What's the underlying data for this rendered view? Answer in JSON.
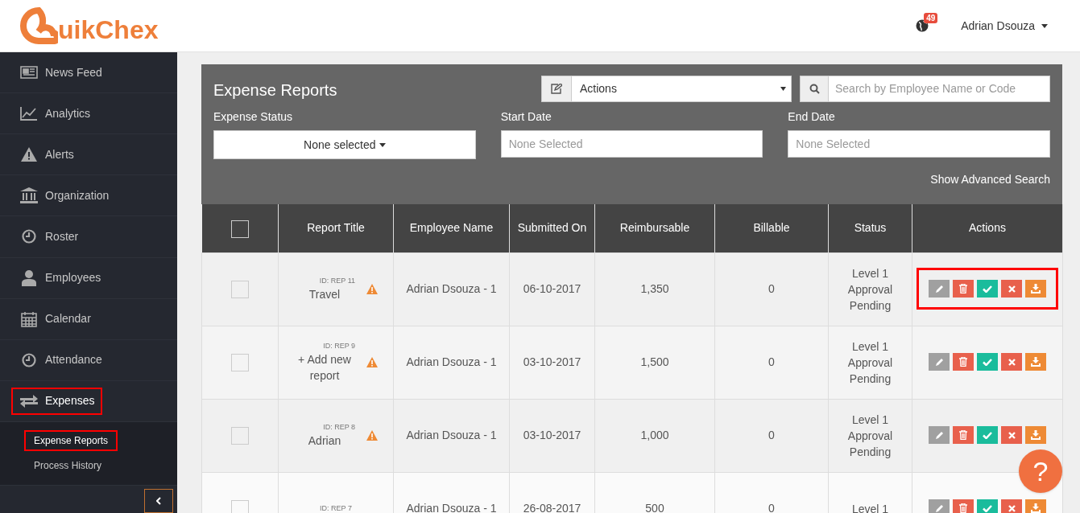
{
  "header": {
    "logo": "uikChex",
    "notification_count": "49",
    "user": "Adrian Dsouza"
  },
  "sidebar": {
    "items": [
      {
        "label": "News Feed",
        "selected": false,
        "annotated": false
      },
      {
        "label": "Analytics",
        "selected": false,
        "annotated": false
      },
      {
        "label": "Alerts",
        "selected": false,
        "annotated": false
      },
      {
        "label": "Organization",
        "selected": false,
        "annotated": false
      },
      {
        "label": "Roster",
        "selected": false,
        "annotated": false
      },
      {
        "label": "Employees",
        "selected": false,
        "annotated": false
      },
      {
        "label": "Calendar",
        "selected": false,
        "annotated": false
      },
      {
        "label": "Attendance",
        "selected": false,
        "annotated": false
      },
      {
        "label": "Expenses",
        "selected": true,
        "annotated": true,
        "children": [
          {
            "label": "Expense Reports",
            "selected": true,
            "annotated": true
          },
          {
            "label": "Process History",
            "selected": false,
            "annotated": false
          }
        ]
      }
    ]
  },
  "panel": {
    "title": "Expense Reports",
    "actions_select": "Actions",
    "search": {
      "placeholder": "Search by Employee Name or Code"
    },
    "filters": [
      {
        "kind": "dropdown",
        "label": "Expense Status",
        "value": "None selected"
      },
      {
        "kind": "date",
        "label": "Start Date",
        "placeholder": "None Selected"
      },
      {
        "kind": "date",
        "label": "End Date",
        "placeholder": "None Selected"
      }
    ],
    "advanced_link": "Show Advanced Search"
  },
  "table": {
    "select_all_checked": false,
    "columns": [
      "Report Title",
      "Employee Name",
      "Submitted On",
      "Reimbursable",
      "Billable",
      "Status",
      "Actions"
    ],
    "rows": [
      {
        "checked": false,
        "id": "ID: REP 11",
        "title": "Travel",
        "warning": true,
        "employee": "Adrian Dsouza - 1",
        "submitted": "06-10-2017",
        "reimbursable": "1,350",
        "billable": "0",
        "status": "Level 1 Approval Pending",
        "actions_annotated": true
      },
      {
        "checked": false,
        "id": "ID: REP 9",
        "title": "+ Add new report",
        "warning": true,
        "employee": "Adrian Dsouza - 1",
        "submitted": "03-10-2017",
        "reimbursable": "1,500",
        "billable": "0",
        "status": "Level 1 Approval Pending",
        "actions_annotated": false
      },
      {
        "checked": false,
        "id": "ID: REP 8",
        "title": "Adrian",
        "warning": true,
        "employee": "Adrian Dsouza - 1",
        "submitted": "03-10-2017",
        "reimbursable": "1,000",
        "billable": "0",
        "status": "Level 1 Approval Pending",
        "actions_annotated": false
      },
      {
        "checked": false,
        "id": "ID: REP 7",
        "employee": "Adrian Dsouza - 1",
        "submitted": "26-08-2017",
        "reimbursable": "500",
        "billable": "0",
        "status": "Level 1"
      }
    ]
  },
  "help_button": "?"
}
